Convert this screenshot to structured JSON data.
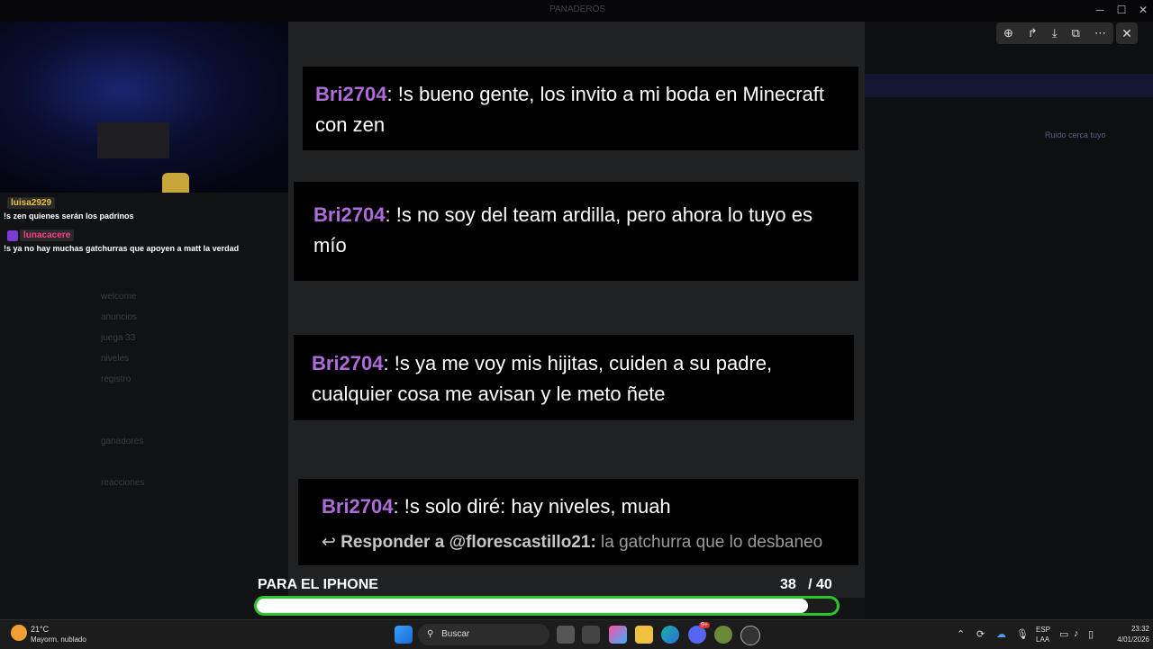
{
  "window": {
    "title": "PANADEROS"
  },
  "viewer": {
    "tools": [
      "zoom-in-icon",
      "share-icon",
      "download-icon",
      "open-external-icon",
      "more-icon"
    ],
    "close": "✕"
  },
  "discord": {
    "hint": "Ruido cerca tuyo",
    "channels": [
      "welcome",
      "anuncios",
      "juega 33",
      "niveles",
      "registro",
      "",
      "",
      "ganadores",
      "",
      "reacciones"
    ]
  },
  "stream_chat": [
    {
      "user": "luisa2929",
      "user_color": "#f0c040",
      "text": "!s zen quienes serán los padrinos"
    },
    {
      "user": "lunacacere",
      "user_color": "#ff3b8b",
      "text": "!s ya no hay muchas gatchurras que apoyen a matt la verdad"
    }
  ],
  "messages": [
    {
      "user": "Bri2704",
      "text": ": !s bueno gente, los invito a mi boda en Minecraft con zen"
    },
    {
      "user": "Bri2704",
      "text": ": !s no soy del team ardilla, pero ahora lo tuyo es mío"
    },
    {
      "user": "Bri2704",
      "text": ": !s ya me voy mis hijitas, cuiden a su padre, cualquier cosa me avisan y le meto ñete"
    },
    {
      "user": "Bri2704",
      "text": ": !s solo diré: hay niveles, muah"
    }
  ],
  "reply": {
    "target": "Responder a @florescastillo21:",
    "text": " la gatchurra que lo desbaneo"
  },
  "goal": {
    "label": "PARA EL IPHONE",
    "current": "38",
    "total": "/ 40",
    "progress": 0.95
  },
  "taskbar": {
    "weather_temp": "21°C",
    "weather_desc": "Mayorm. nublado",
    "search": "Buscar",
    "lang": "ESP",
    "lang2": "LAA",
    "time": "23:32",
    "date": "4/01/2026",
    "discord_badge": "9+",
    "colors": {
      "accent": "#2cc62c",
      "username": "#b06bdb"
    }
  }
}
